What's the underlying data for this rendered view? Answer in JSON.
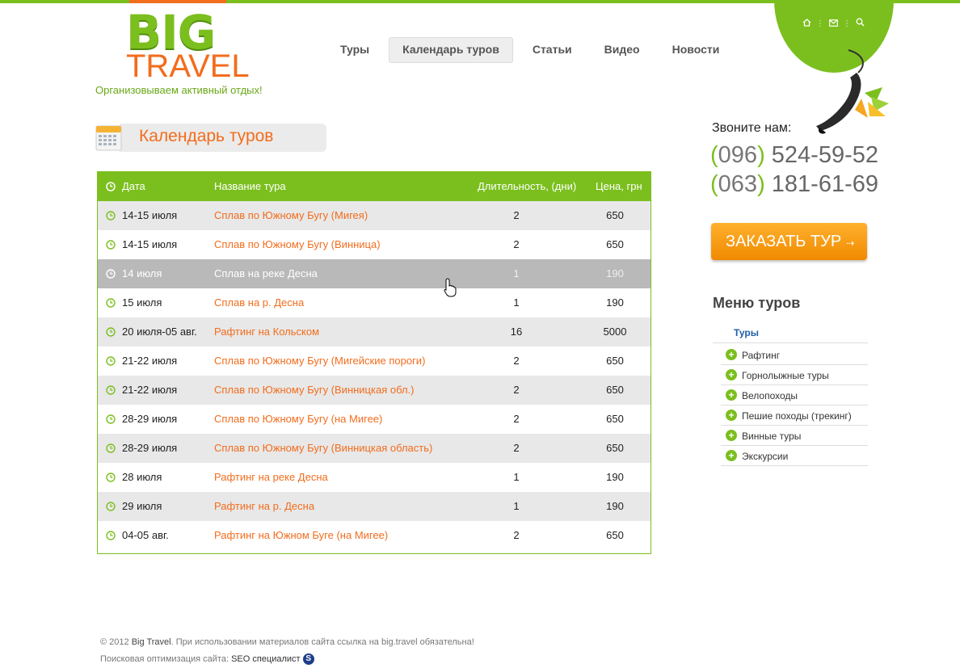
{
  "logo": {
    "big": "BIG",
    "travel": "TRAVEL",
    "slogan": "Организовываем активный отдых!"
  },
  "nav": [
    {
      "label": "Туры",
      "active": false
    },
    {
      "label": "Календарь туров",
      "active": true
    },
    {
      "label": "Статьи",
      "active": false
    },
    {
      "label": "Видео",
      "active": false
    },
    {
      "label": "Новости",
      "active": false
    }
  ],
  "header_icons": [
    "home-icon",
    "mail-icon",
    "search-icon"
  ],
  "page": {
    "title": "Календарь туров"
  },
  "table": {
    "headers": {
      "date": "Дата",
      "name": "Название тура",
      "duration": "Длительность, (дни)",
      "price": "Цена, грн"
    },
    "rows": [
      {
        "date": "14-15 июля",
        "name": "Сплав по Южному Бугу (Мигея)",
        "duration": "2",
        "price": "650"
      },
      {
        "date": "14-15 июля",
        "name": "Сплав по Южному Бугу (Винница)",
        "duration": "2",
        "price": "650"
      },
      {
        "date": "14 июля",
        "name": "Сплав на реке Десна",
        "duration": "1",
        "price": "190"
      },
      {
        "date": "15 июля",
        "name": "Сплав на р. Десна",
        "duration": "1",
        "price": "190"
      },
      {
        "date": "20 июля-05 авг.",
        "name": "Рафтинг на Кольском",
        "duration": "16",
        "price": "5000"
      },
      {
        "date": "21-22 июля",
        "name": "Сплав по Южному Бугу (Мигейские пороги)",
        "duration": "2",
        "price": "650"
      },
      {
        "date": "21-22 июля",
        "name": "Сплав по Южному Бугу (Винницкая обл.)",
        "duration": "2",
        "price": "650"
      },
      {
        "date": "28-29 июля",
        "name": "Сплав по Южному Бугу (на Мигее)",
        "duration": "2",
        "price": "650"
      },
      {
        "date": "28-29 июля",
        "name": "Сплав по Южному Бугу (Винницкая область)",
        "duration": "2",
        "price": "650"
      },
      {
        "date": "28 июля",
        "name": "Рафтинг на реке Десна",
        "duration": "1",
        "price": "190"
      },
      {
        "date": "29 июля",
        "name": "Рафтинг на р. Десна",
        "duration": "1",
        "price": "190"
      },
      {
        "date": "04-05 авг.",
        "name": "Рафтинг на Южном Буге (на Мигее)",
        "duration": "2",
        "price": "650"
      }
    ],
    "hover_row": 2
  },
  "contact": {
    "label": "Звоните нам:",
    "phones": [
      {
        "code": "096",
        "number": "524-59-52"
      },
      {
        "code": "063",
        "number": "181-61-69"
      }
    ]
  },
  "order_button": {
    "label": "ЗАКАЗАТЬ ТУР",
    "arrow": "⇢"
  },
  "tour_menu": {
    "title": "Меню туров",
    "heading": "Туры",
    "items": [
      "Рафтинг",
      "Горнолыжные туры",
      "Велопоходы",
      "Пешие походы (трекинг)",
      "Винные туры",
      "Экскурсии"
    ]
  },
  "footer": {
    "copyright": "© 2012",
    "owner": "Big Travel",
    "notice": ". При использовании материалов сайта ссылка на big.travel обязательна!",
    "seo_label": "Поисковая оптимизация сайта: ",
    "seo_link": "SEO специалист",
    "seo_badge": "S"
  },
  "colors": {
    "green": "#7bbf1e",
    "orange": "#f26d1d",
    "link_blue": "#1f5fa8"
  }
}
